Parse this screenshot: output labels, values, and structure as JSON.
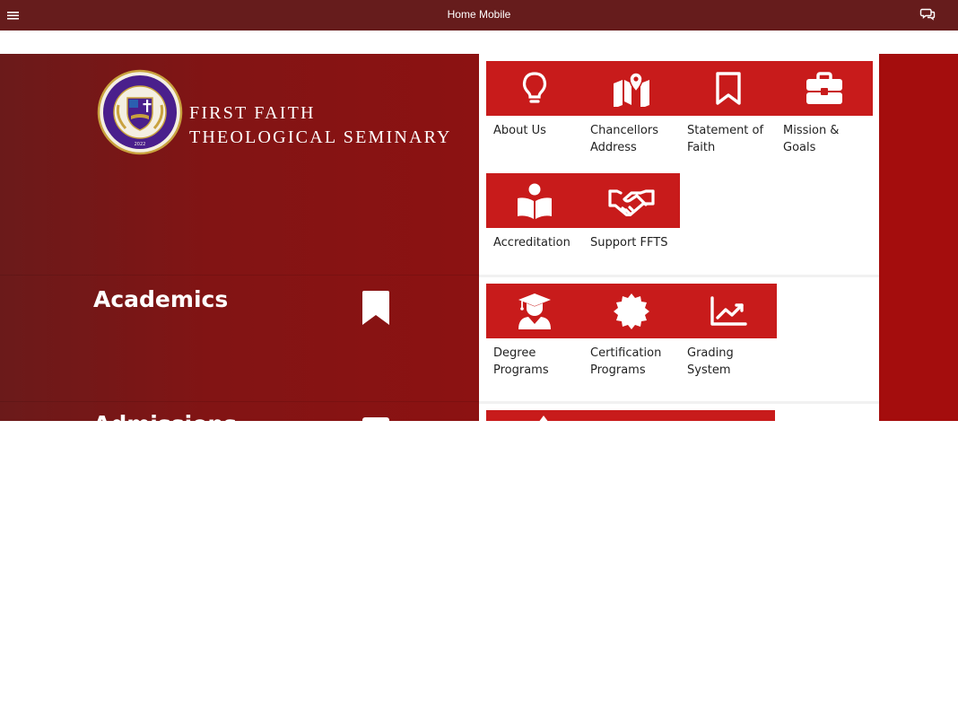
{
  "topbar": {
    "title": "Home Mobile",
    "menu_icon": "hamburger-icon",
    "chat_icon": "chat-bubbles-icon"
  },
  "logo": {
    "line1": "FIRST FAITH",
    "line2": "THEOLOGICAL SEMINARY",
    "seal_text": "FIRST FAITH THEOLOGICAL SEMINARY",
    "seal_year": "2022"
  },
  "sections": [
    {
      "title": "Academics",
      "icon": "bookmark-icon"
    },
    {
      "title": "Admissions",
      "icon": "calendar-icon"
    }
  ],
  "tiles": {
    "about": {
      "label": "About Us",
      "icon": "lightbulb-icon"
    },
    "chancellors": {
      "label": "Chancellors Address",
      "icon": "map-pin-icon"
    },
    "statement": {
      "label": "Statement of Faith",
      "icon": "bookmark-icon"
    },
    "mission": {
      "label": "Mission & Goals",
      "icon": "briefcase-icon"
    },
    "accreditation": {
      "label": "Accreditation",
      "icon": "reader-icon"
    },
    "support": {
      "label": "Support FFTS",
      "icon": "handshake-icon"
    },
    "degree": {
      "label": "Degree Programs",
      "icon": "graduate-icon"
    },
    "certification": {
      "label": "Certification Programs",
      "icon": "certificate-icon"
    },
    "grading": {
      "label": "Grading System",
      "icon": "chart-icon"
    }
  },
  "colors": {
    "topbar": "#661c1c",
    "tile": "#c81b1b",
    "accent_right": "#a40d0d",
    "seal_purple": "#4a1f8c",
    "seal_gold": "#c9a23e"
  }
}
